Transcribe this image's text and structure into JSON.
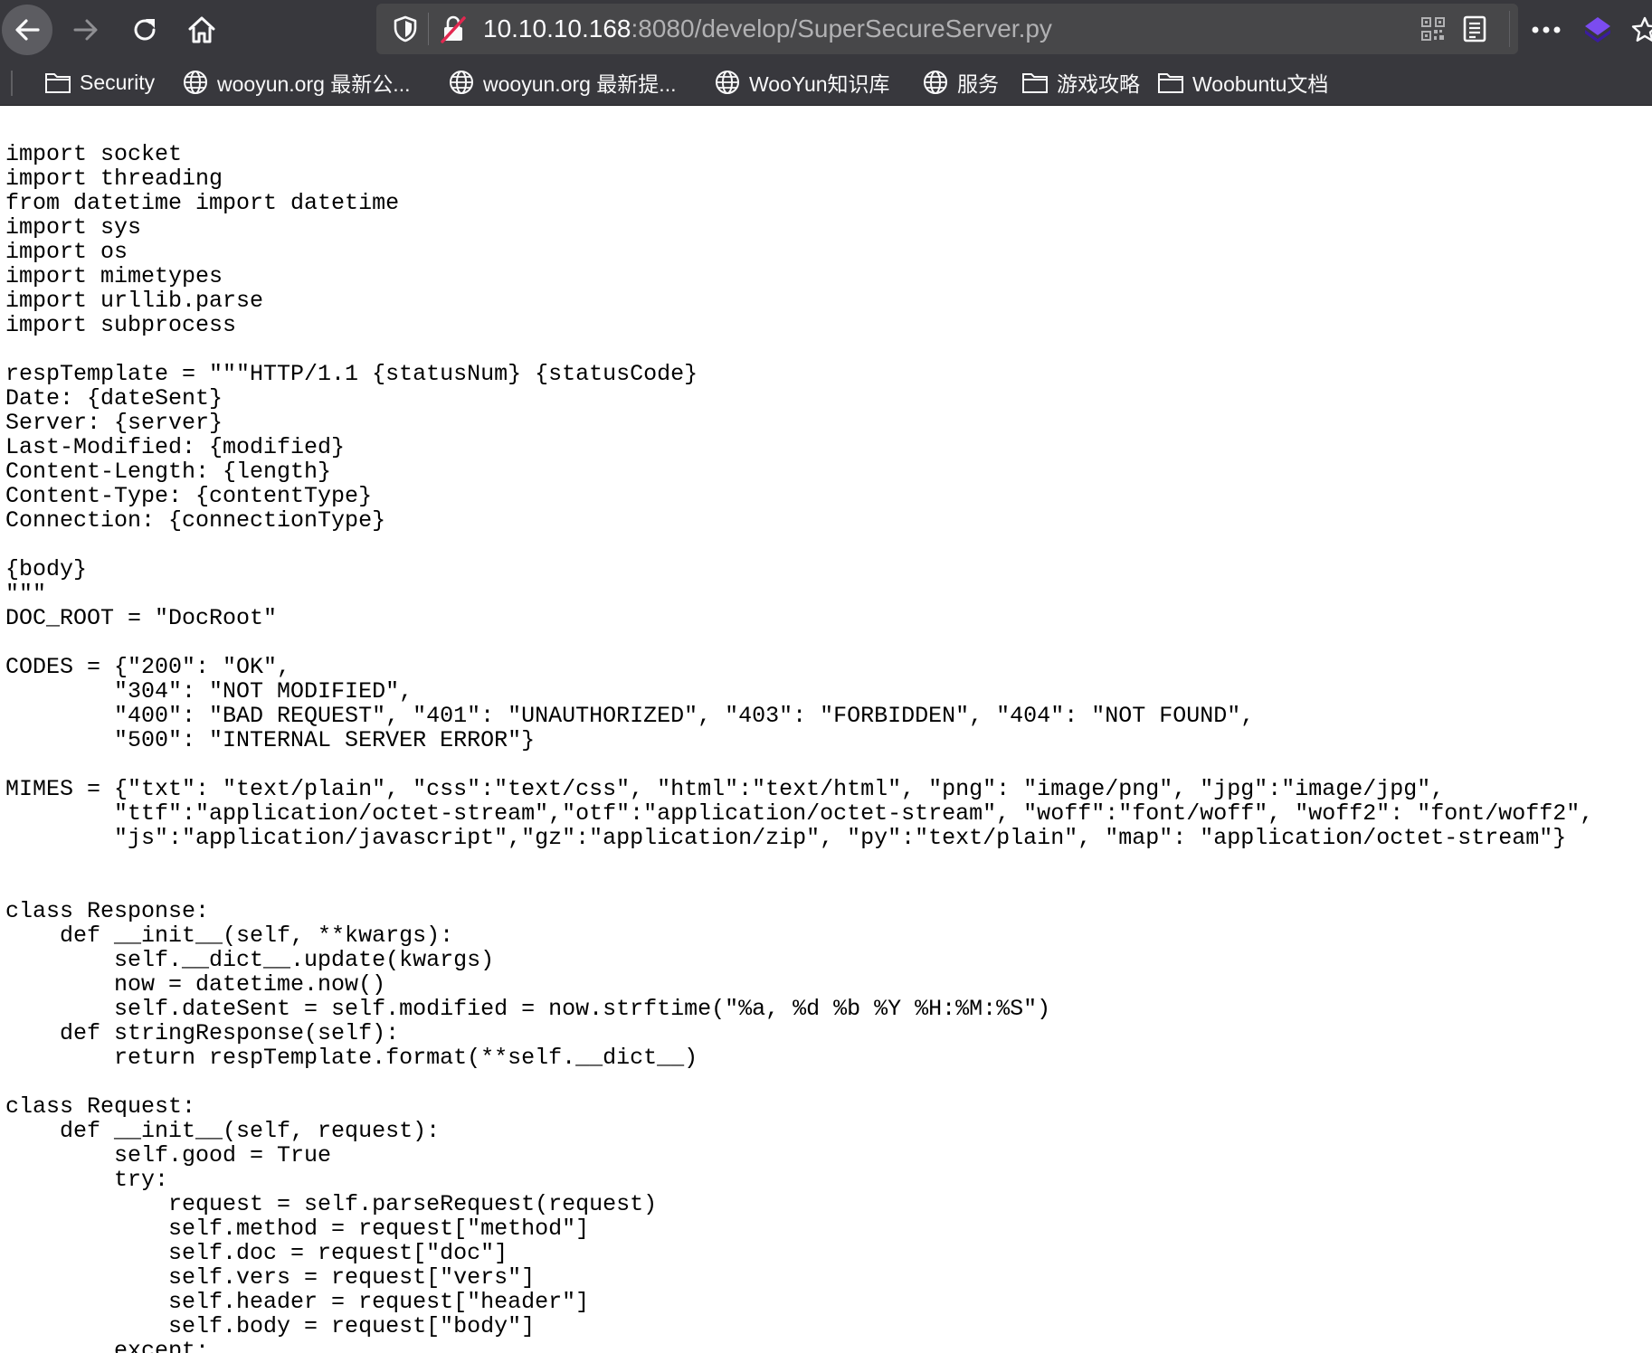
{
  "browser": {
    "url_host": "10.10.10.168",
    "url_path": ":8080/develop/SuperSecureServer.py"
  },
  "bookmarks": [
    {
      "label": "Security",
      "icon": "folder-icon"
    },
    {
      "label": "wooyun.org 最新公...",
      "icon": "globe-icon"
    },
    {
      "label": "wooyun.org 最新提...",
      "icon": "globe-icon"
    },
    {
      "label": "WooYun知识库",
      "icon": "globe-icon"
    },
    {
      "label": "服务",
      "icon": "globe-icon"
    },
    {
      "label": "游戏攻略",
      "icon": "folder-icon"
    },
    {
      "label": "Woobuntu文档",
      "icon": "folder-icon"
    }
  ],
  "colors": {
    "toolbar": "#38383d",
    "urlbar": "#474749",
    "url_host": "#fbfbfe",
    "url_path": "#b1b1b3",
    "insecure_red": "#e22850",
    "extension_purple": "#5b2bd6"
  },
  "content": {
    "source_code": "import socket\nimport threading\nfrom datetime import datetime\nimport sys\nimport os\nimport mimetypes\nimport urllib.parse\nimport subprocess\n\nrespTemplate = \"\"\"HTTP/1.1 {statusNum} {statusCode}\nDate: {dateSent}\nServer: {server}\nLast-Modified: {modified}\nContent-Length: {length}\nContent-Type: {contentType}\nConnection: {connectionType}\n\n{body}\n\"\"\"\nDOC_ROOT = \"DocRoot\"\n\nCODES = {\"200\": \"OK\",\n        \"304\": \"NOT MODIFIED\",\n        \"400\": \"BAD REQUEST\", \"401\": \"UNAUTHORIZED\", \"403\": \"FORBIDDEN\", \"404\": \"NOT FOUND\",\n        \"500\": \"INTERNAL SERVER ERROR\"}\n\nMIMES = {\"txt\": \"text/plain\", \"css\":\"text/css\", \"html\":\"text/html\", \"png\": \"image/png\", \"jpg\":\"image/jpg\",\n        \"ttf\":\"application/octet-stream\",\"otf\":\"application/octet-stream\", \"woff\":\"font/woff\", \"woff2\": \"font/woff2\",\n        \"js\":\"application/javascript\",\"gz\":\"application/zip\", \"py\":\"text/plain\", \"map\": \"application/octet-stream\"}\n\n\nclass Response:\n    def __init__(self, **kwargs):\n        self.__dict__.update(kwargs)\n        now = datetime.now()\n        self.dateSent = self.modified = now.strftime(\"%a, %d %b %Y %H:%M:%S\")\n    def stringResponse(self):\n        return respTemplate.format(**self.__dict__)\n\nclass Request:\n    def __init__(self, request):\n        self.good = True\n        try:\n            request = self.parseRequest(request)\n            self.method = request[\"method\"]\n            self.doc = request[\"doc\"]\n            self.vers = request[\"vers\"]\n            self.header = request[\"header\"]\n            self.body = request[\"body\"]\n        except:"
  }
}
